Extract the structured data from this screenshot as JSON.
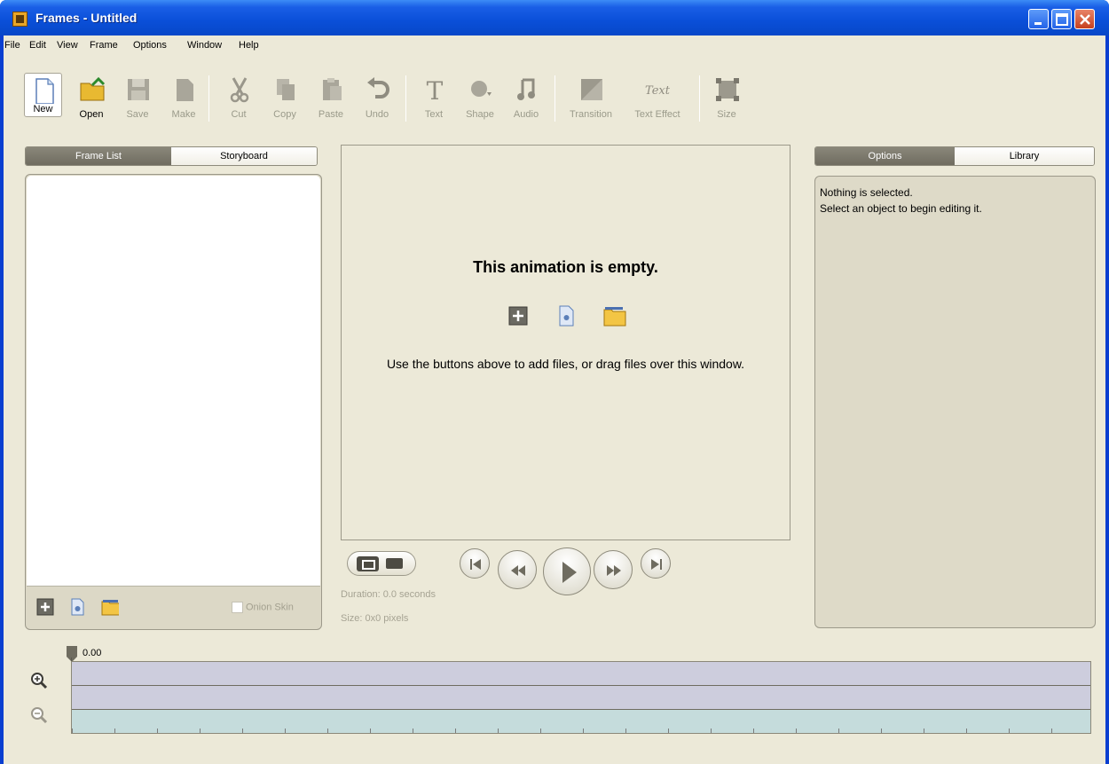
{
  "window": {
    "title": "Frames - Untitled"
  },
  "menu": [
    "File",
    "Edit",
    "View",
    "Frame",
    "Options",
    "Window",
    "Help"
  ],
  "toolbar": {
    "new": "New",
    "open": "Open",
    "save": "Save",
    "make": "Make",
    "cut": "Cut",
    "copy": "Copy",
    "paste": "Paste",
    "undo": "Undo",
    "text": "Text",
    "shape": "Shape",
    "audio": "Audio",
    "transition": "Transition",
    "text_effect": "Text Effect",
    "size": "Size"
  },
  "left_tabs": {
    "frame_list": "Frame List",
    "storyboard": "Storyboard"
  },
  "right_tabs": {
    "options": "Options",
    "library": "Library"
  },
  "onion_skin": "Onion Skin",
  "canvas": {
    "title": "This animation is empty.",
    "hint": "Use the buttons above to add files, or drag files over this window."
  },
  "info": {
    "duration": "Duration: 0.0 seconds",
    "size": "Size: 0x0 pixels"
  },
  "options_panel": {
    "line1": "Nothing is selected.",
    "line2": "Select an object to begin editing it."
  },
  "timeline": {
    "time": "0.00"
  },
  "colors": {
    "accent": "#0a4fd8",
    "panel": "#ece9d8",
    "track": "#cdcddd",
    "audio_track": "#c5dcdc"
  }
}
